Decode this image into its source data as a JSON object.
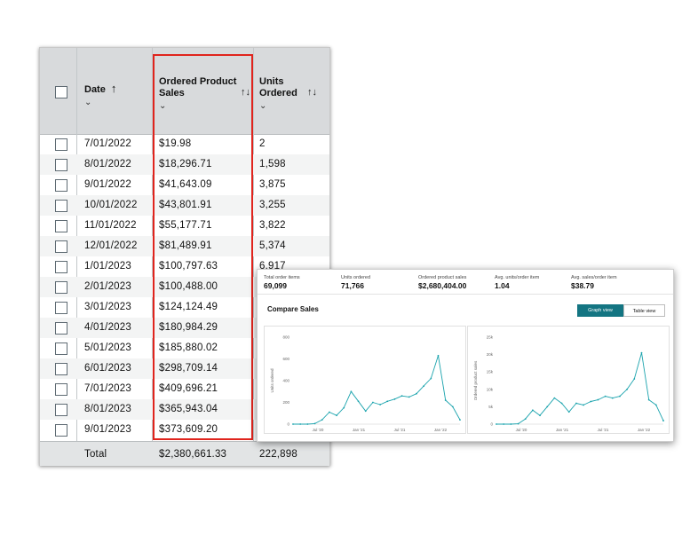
{
  "table": {
    "headers": {
      "date": "Date",
      "sales_line1": "Ordered Product",
      "sales_line2": "Sales",
      "units_line1": "Units",
      "units_line2": "Ordered"
    },
    "rows": [
      {
        "date": "7/01/2022",
        "sales": "$19.98",
        "units": "2"
      },
      {
        "date": "8/01/2022",
        "sales": "$18,296.71",
        "units": "1,598"
      },
      {
        "date": "9/01/2022",
        "sales": "$41,643.09",
        "units": "3,875"
      },
      {
        "date": "10/01/2022",
        "sales": "$43,801.91",
        "units": "3,255"
      },
      {
        "date": "11/01/2022",
        "sales": "$55,177.71",
        "units": "3,822"
      },
      {
        "date": "12/01/2022",
        "sales": "$81,489.91",
        "units": "5,374"
      },
      {
        "date": "1/01/2023",
        "sales": "$100,797.63",
        "units": "6,917"
      },
      {
        "date": "2/01/2023",
        "sales": "$100,488.00",
        "units": ""
      },
      {
        "date": "3/01/2023",
        "sales": "$124,124.49",
        "units": ""
      },
      {
        "date": "4/01/2023",
        "sales": "$180,984.29",
        "units": ""
      },
      {
        "date": "5/01/2023",
        "sales": "$185,880.02",
        "units": ""
      },
      {
        "date": "6/01/2023",
        "sales": "$298,709.14",
        "units": ""
      },
      {
        "date": "7/01/2023",
        "sales": "$409,696.21",
        "units": ""
      },
      {
        "date": "8/01/2023",
        "sales": "$365,943.04",
        "units": ""
      },
      {
        "date": "9/01/2023",
        "sales": "$373,609.20",
        "units": ""
      }
    ],
    "total": {
      "label": "Total",
      "sales": "$2,380,661.33",
      "units": "222,898"
    },
    "highlight_color": "#e0241d"
  },
  "dashboard": {
    "kpis": [
      {
        "label": "Total order items",
        "value": "69,099"
      },
      {
        "label": "Units ordered",
        "value": "71,766"
      },
      {
        "label": "Ordered product sales",
        "value": "$2,680,404.00"
      },
      {
        "label": "Avg. units/order item",
        "value": "1.04"
      },
      {
        "label": "Avg. sales/order item",
        "value": "$38.79"
      }
    ],
    "compare_title": "Compare Sales",
    "graph_view_label": "Graph view",
    "table_view_label": "Table view",
    "accent_color": "#147582",
    "line_color": "#1aa3ad"
  },
  "chart_data": [
    {
      "type": "line",
      "ylabel": "Units ordered",
      "y_ticks": [
        "800",
        "600",
        "400",
        "200",
        "0"
      ],
      "x_ticks": [
        "Jul '20",
        "Jan '21",
        "Jul '21",
        "Jan '22"
      ],
      "ylim": [
        0,
        800
      ],
      "x": [
        "2020-04",
        "2020-05",
        "2020-06",
        "2020-07",
        "2020-08",
        "2020-09",
        "2020-10",
        "2020-11",
        "2020-12",
        "2021-01",
        "2021-02",
        "2021-03",
        "2021-04",
        "2021-05",
        "2021-06",
        "2021-07",
        "2021-08",
        "2021-09",
        "2021-10",
        "2021-11",
        "2021-12",
        "2022-01",
        "2022-02",
        "2022-03"
      ],
      "values": [
        0,
        0,
        0,
        5,
        40,
        110,
        80,
        150,
        300,
        210,
        120,
        200,
        180,
        210,
        230,
        260,
        250,
        280,
        350,
        420,
        630,
        220,
        160,
        40
      ]
    },
    {
      "type": "line",
      "ylabel": "Ordered product sales",
      "y_ticks": [
        "25k",
        "20k",
        "15k",
        "10k",
        "5k",
        "0"
      ],
      "x_ticks": [
        "Jul '20",
        "Jan '21",
        "Jul '21",
        "Jan '22"
      ],
      "ylim": [
        0,
        25000
      ],
      "x": [
        "2020-04",
        "2020-05",
        "2020-06",
        "2020-07",
        "2020-08",
        "2020-09",
        "2020-10",
        "2020-11",
        "2020-12",
        "2021-01",
        "2021-02",
        "2021-03",
        "2021-04",
        "2021-05",
        "2021-06",
        "2021-07",
        "2021-08",
        "2021-09",
        "2021-10",
        "2021-11",
        "2021-12",
        "2022-01",
        "2022-02",
        "2022-03"
      ],
      "values": [
        0,
        0,
        0,
        100,
        1500,
        4000,
        2500,
        5000,
        7500,
        6000,
        3500,
        6000,
        5500,
        6500,
        7000,
        8000,
        7500,
        8000,
        10000,
        13000,
        20500,
        7000,
        5500,
        1000
      ]
    }
  ]
}
